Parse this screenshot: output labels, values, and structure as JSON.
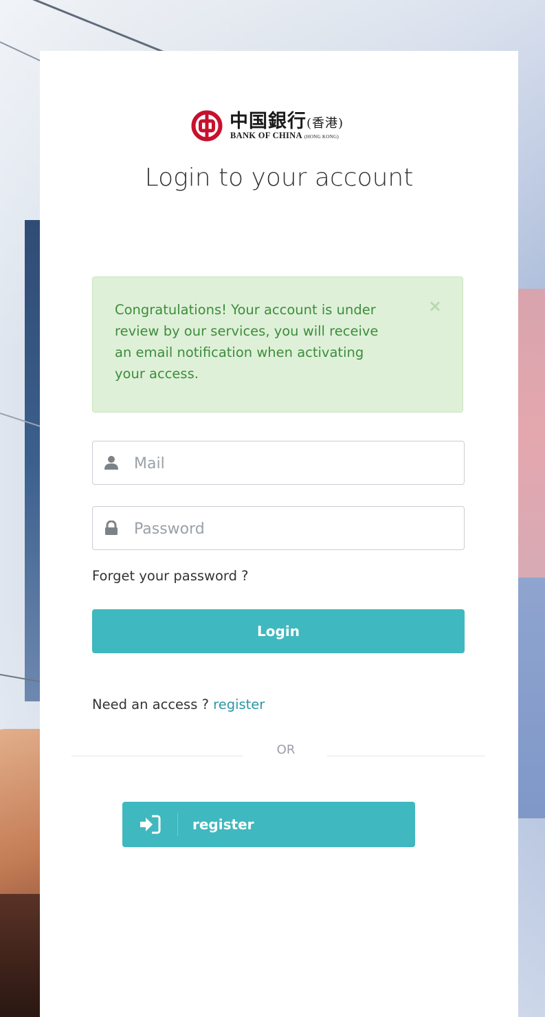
{
  "brand": {
    "name_cn": "中国銀行",
    "region_cn": "(香港)",
    "name_en": "BANK OF CHINA",
    "region_en": "(HONG KONG)",
    "logo_color": "#c8102e"
  },
  "login": {
    "title": "Login to your account",
    "alert": {
      "message": "Congratulations! Your account is under review by our services, you will receive an email notification when activating your access.",
      "close_label": "×"
    },
    "mail": {
      "placeholder": "Mail",
      "value": ""
    },
    "password": {
      "placeholder": "Password",
      "value": ""
    },
    "forgot_label": "Forget your password ?",
    "login_button": "Login",
    "need_access_text": "Need an access ?",
    "register_link": "register",
    "divider_label": "OR",
    "register_button": "register"
  },
  "colors": {
    "accent": "#40b8bf",
    "link": "#2a97a1",
    "alert_bg": "#dff0d8",
    "alert_text": "#3c8d3c"
  }
}
